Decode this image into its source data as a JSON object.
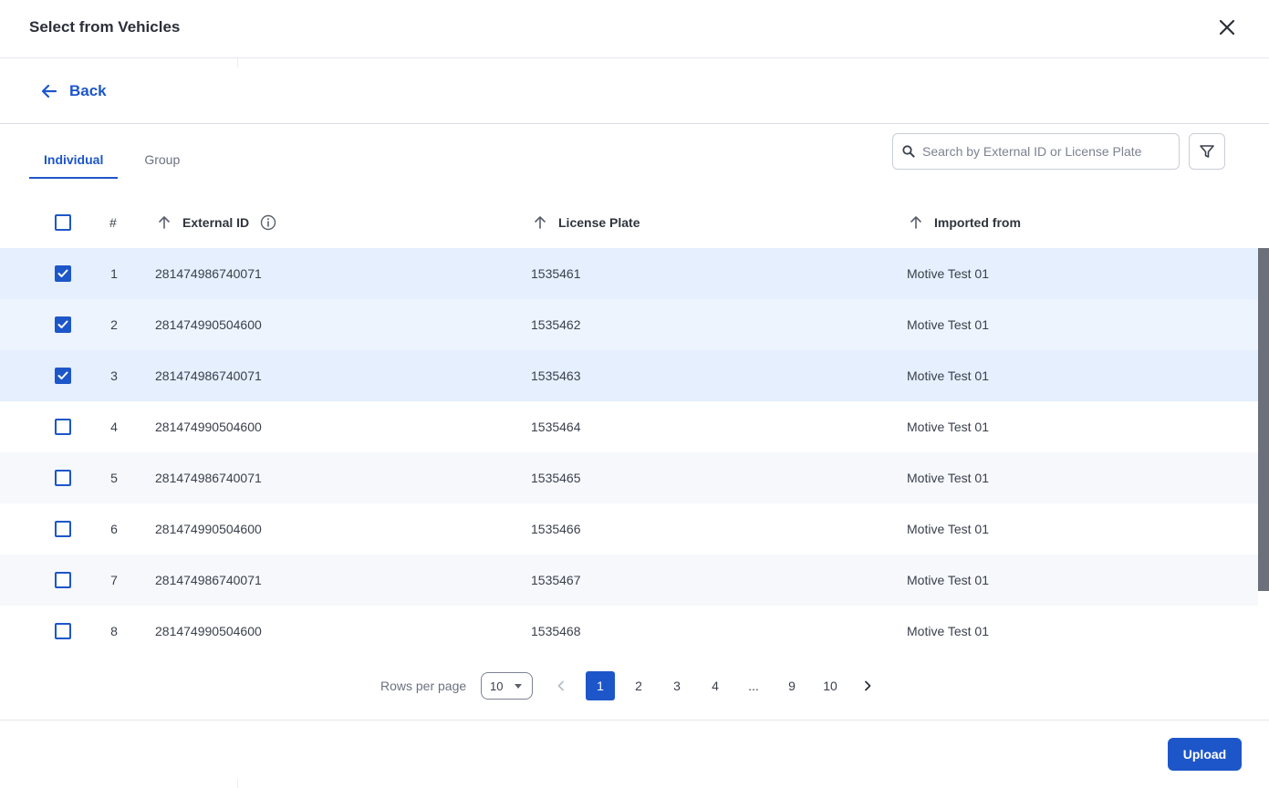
{
  "header": {
    "title": "Select from Vehicles"
  },
  "nav": {
    "back_label": "Back"
  },
  "tabs": [
    {
      "label": "Individual",
      "active": true
    },
    {
      "label": "Group",
      "active": false
    }
  ],
  "search": {
    "placeholder": "Search by External ID or License Plate",
    "value": ""
  },
  "table": {
    "columns": {
      "index": "#",
      "external_id": "External ID",
      "license_plate": "License Plate",
      "imported_from": "Imported from"
    },
    "rows": [
      {
        "index": "1",
        "external_id": "281474986740071",
        "license_plate": "1535461",
        "imported_from": "Motive Test 01",
        "checked": true
      },
      {
        "index": "2",
        "external_id": "281474990504600",
        "license_plate": "1535462",
        "imported_from": "Motive Test 01",
        "checked": true
      },
      {
        "index": "3",
        "external_id": "281474986740071",
        "license_plate": "1535463",
        "imported_from": "Motive Test 01",
        "checked": true
      },
      {
        "index": "4",
        "external_id": "281474990504600",
        "license_plate": "1535464",
        "imported_from": "Motive Test 01",
        "checked": false
      },
      {
        "index": "5",
        "external_id": "281474986740071",
        "license_plate": "1535465",
        "imported_from": "Motive Test 01",
        "checked": false
      },
      {
        "index": "6",
        "external_id": "281474990504600",
        "license_plate": "1535466",
        "imported_from": "Motive Test 01",
        "checked": false
      },
      {
        "index": "7",
        "external_id": "281474986740071",
        "license_plate": "1535467",
        "imported_from": "Motive Test 01",
        "checked": false
      },
      {
        "index": "8",
        "external_id": "281474990504600",
        "license_plate": "1535468",
        "imported_from": "Motive Test 01",
        "checked": false
      }
    ]
  },
  "pagination": {
    "rows_per_page_label": "Rows per page",
    "rows_per_page_value": "10",
    "pages": [
      "1",
      "2",
      "3",
      "4",
      "...",
      "9",
      "10"
    ],
    "current_page": "1"
  },
  "footer": {
    "upload_label": "Upload"
  },
  "icons": {
    "close": "close-icon",
    "back": "arrow-left-icon",
    "search": "search-icon",
    "filter": "filter-icon",
    "sort": "arrow-up-icon",
    "info": "info-icon",
    "check": "check-icon",
    "prev": "chevron-left-icon",
    "next": "chevron-right-icon"
  },
  "colors": {
    "primary": "#1d56c9",
    "row_selected": "#e5effd",
    "row_alt": "#f6f8fc",
    "scrollbar": "#6b707a"
  }
}
